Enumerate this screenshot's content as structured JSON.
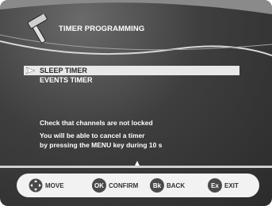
{
  "header": {
    "title": "TIMER PROGRAMMING"
  },
  "menu": {
    "items": [
      {
        "label": "SLEEP TIMER",
        "selected": true
      },
      {
        "label": "EVENTS TIMER",
        "selected": false
      }
    ]
  },
  "info": {
    "line1": "Check that channels are not locked",
    "line2": "You will be able to cancel a timer",
    "line3": "by pressing the MENU key during 10 s"
  },
  "footer": {
    "move_label": "MOVE",
    "ok_badge": "OK",
    "confirm_label": "CONFIRM",
    "bk_badge": "Bk",
    "back_label": "BACK",
    "ex_badge": "Ex",
    "exit_label": "EXIT"
  }
}
